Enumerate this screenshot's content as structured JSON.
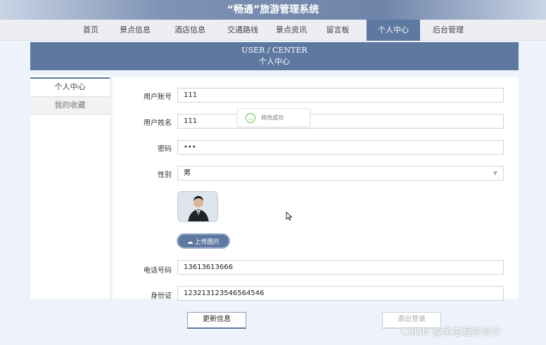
{
  "header": {
    "title": "“畅通”旅游管理系统"
  },
  "nav": {
    "items": [
      {
        "label": "首页"
      },
      {
        "label": "景点信息"
      },
      {
        "label": "酒店信息"
      },
      {
        "label": "交通路线"
      },
      {
        "label": "景点资讯"
      },
      {
        "label": "留言板"
      },
      {
        "label": "个人中心",
        "active": true
      },
      {
        "label": "后台管理"
      }
    ]
  },
  "banner": {
    "en": "USER / CENTER",
    "cn": "个人中心"
  },
  "sidebar": {
    "items": [
      {
        "label": "个人中心",
        "active": true
      },
      {
        "label": "我的收藏"
      }
    ]
  },
  "form": {
    "account": {
      "label": "用户账号",
      "value": "111"
    },
    "name": {
      "label": "用户姓名",
      "value": "111"
    },
    "password": {
      "label": "密码",
      "value": "•••"
    },
    "gender": {
      "label": "性别",
      "value": "男"
    },
    "upload_label": "上传图片",
    "phone": {
      "label": "电话号码",
      "value": "13613613666"
    },
    "id_card": {
      "label": "身份证",
      "value": "123213123546564546"
    }
  },
  "toast": {
    "text": "修改成功",
    "icon": "smile-check-icon"
  },
  "actions": {
    "update": "更新信息",
    "logout": "退出登录"
  },
  "watermark": "CSDN @承志程序设计",
  "colors": {
    "primary": "#5e79a0",
    "success": "#67c23a",
    "background": "#eef3fb"
  }
}
